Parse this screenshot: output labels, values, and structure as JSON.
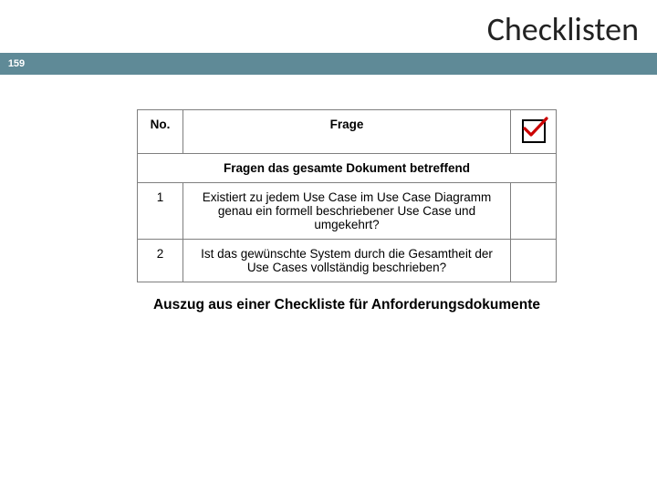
{
  "title": "Checklisten",
  "page_number": "159",
  "table": {
    "headers": {
      "no": "No.",
      "frage": "Frage"
    },
    "section": "Fragen das gesamte Dokument betreffend",
    "rows": [
      {
        "no": "1",
        "question": "Existiert zu jedem Use Case im Use Case Diagramm genau ein formell beschriebener Use Case und umgekehrt?"
      },
      {
        "no": "2",
        "question": "Ist das gewünschte System durch die Gesamtheit der Use Cases vollständig beschrieben?"
      }
    ]
  },
  "caption": "Auszug aus einer Checkliste für Anforderungsdokumente"
}
